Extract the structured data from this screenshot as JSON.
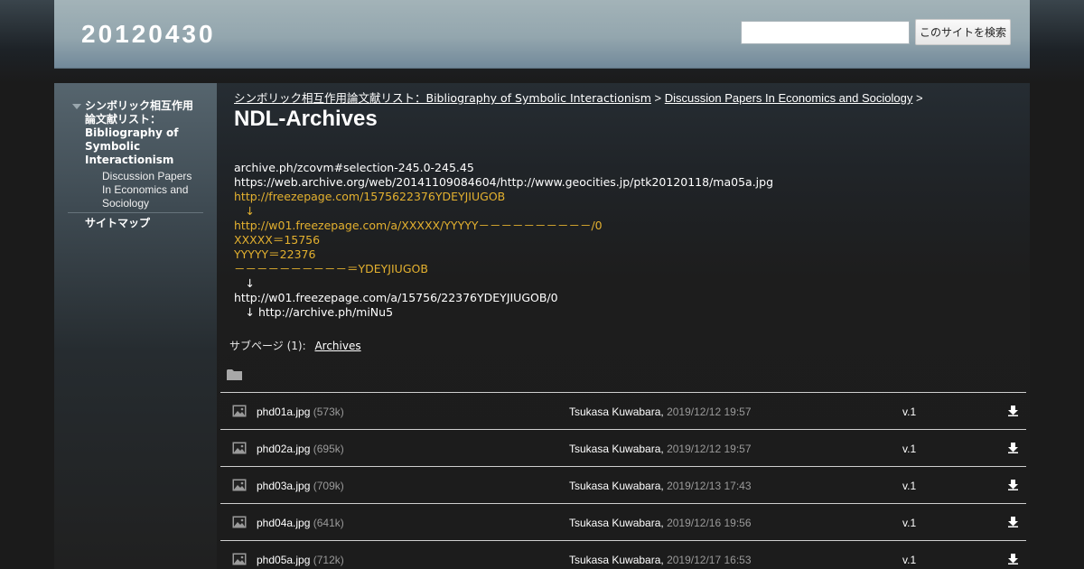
{
  "header": {
    "site_title": "20120430",
    "search_placeholder": "",
    "search_button": "このサイトを検索"
  },
  "sidebar": {
    "top_item": "シンボリック相互作用論文献リスト：Bibliography of Symbolic Interactionism",
    "sub_item": "Discussion Papers In Economics and Sociology",
    "sitemap": "サイトマップ"
  },
  "breadcrumb": {
    "crumb1": "シンボリック相互作用論文献リスト：Bibliography of Symbolic Interactionism",
    "sep": ">",
    "crumb2": "Discussion Papers In Economics and Sociology"
  },
  "page_title": "NDL-Archives",
  "body_lines": [
    {
      "text": "archive.ph/zcovm#selection-245.0-245.45",
      "style": "white"
    },
    {
      "text": "https://web.archive.org/web/20141109084604/http://www.geocities.jp/ptk20120118/ma05a.jpg",
      "style": "white"
    },
    {
      "text": "http://freezepage.com/1575622376YDEYJIUGOB",
      "style": "link"
    },
    {
      "text": "　↓",
      "style": "link"
    },
    {
      "text": "http://w01.freezepage.com/a/XXXXX/YYYYY－－－－－－－－－－/0",
      "style": "link"
    },
    {
      "text": "XXXXX＝15756",
      "style": "link"
    },
    {
      "text": "YYYYY＝22376",
      "style": "link"
    },
    {
      "text": "－－－－－－－－－－＝YDEYJIUGOB",
      "style": "link"
    },
    {
      "text": "　↓",
      "style": "white"
    },
    {
      "text": "http://w01.freezepage.com/a/15756/22376YDEYJIUGOB/0",
      "style": "white"
    },
    {
      "text": "　↓ http://archive.ph/miNu5",
      "style": "white"
    }
  ],
  "subpages": {
    "label": "サブページ (1):",
    "link": "Archives"
  },
  "files": [
    {
      "name": "phd01a.jpg",
      "size": "(573k)",
      "author": "Tsukasa Kuwabara,",
      "date": "2019/12/12 19:57",
      "version": "v.1"
    },
    {
      "name": "phd02a.jpg",
      "size": "(695k)",
      "author": "Tsukasa Kuwabara,",
      "date": "2019/12/12 19:57",
      "version": "v.1"
    },
    {
      "name": "phd03a.jpg",
      "size": "(709k)",
      "author": "Tsukasa Kuwabara,",
      "date": "2019/12/13 17:43",
      "version": "v.1"
    },
    {
      "name": "phd04a.jpg",
      "size": "(641k)",
      "author": "Tsukasa Kuwabara,",
      "date": "2019/12/16 19:56",
      "version": "v.1"
    },
    {
      "name": "phd05a.jpg",
      "size": "(712k)",
      "author": "Tsukasa Kuwabara,",
      "date": "2019/12/17 16:53",
      "version": "v.1"
    }
  ],
  "icons": {
    "folder": "folder-icon",
    "image": "image-file-icon",
    "download": "download-arrow-icon"
  }
}
